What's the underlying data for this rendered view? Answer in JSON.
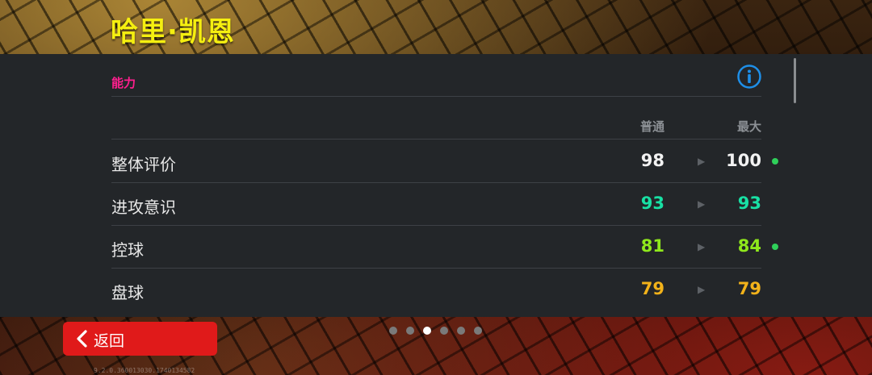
{
  "header": {
    "player_name": "哈里·凯恩"
  },
  "section": {
    "title": "能力",
    "info_icon": "info-circle-icon"
  },
  "columns": {
    "normal": "普通",
    "max": "最大"
  },
  "stats": [
    {
      "label": "整体评价",
      "normal": "98",
      "max": "100",
      "color": "#f2f2f2",
      "improved": true
    },
    {
      "label": "进攻意识",
      "normal": "93",
      "max": "93",
      "color": "#18e0a4",
      "improved": false
    },
    {
      "label": "控球",
      "normal": "81",
      "max": "84",
      "color": "#8fe81c",
      "improved": true
    },
    {
      "label": "盘球",
      "normal": "79",
      "max": "79",
      "color": "#f2b21a",
      "improved": false
    }
  ],
  "pager": {
    "count": 6,
    "active": 2
  },
  "back_button": {
    "label": "返回",
    "icon": "chevron-left-icon"
  },
  "version": "9.2.0.360013030.1740134582",
  "colors": {
    "accent_magenta": "#ff1f8e",
    "back_red": "#e01a1a",
    "title_yellow": "#f5ef10",
    "info_blue": "#1e8fe8",
    "improved_dot": "#2fd05a"
  }
}
